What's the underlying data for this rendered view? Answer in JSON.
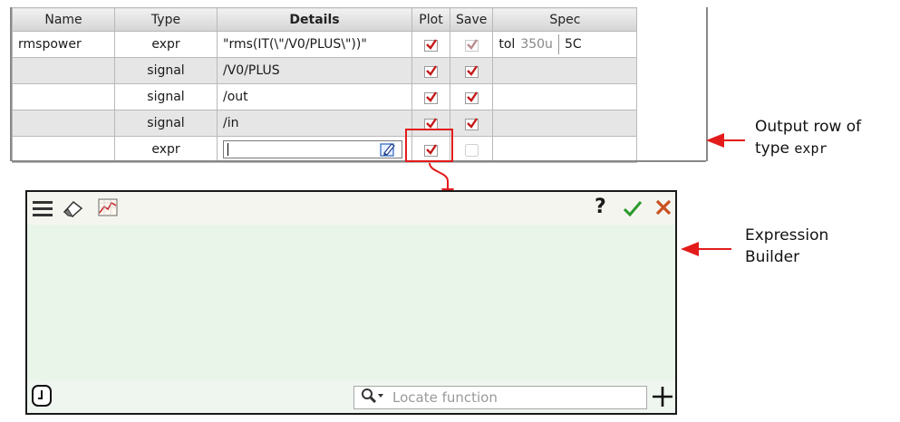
{
  "table": {
    "headers": [
      "Name",
      "Type",
      "Details",
      "Plot",
      "Save",
      "Spec"
    ],
    "rows": [
      {
        "name": "rmspower",
        "type": "expr",
        "details": "\"rms(IT(\\\"/V0/PLUS\\\"))\"",
        "plot": true,
        "save": true,
        "save_dim": true,
        "spec_label": "tol",
        "spec_value": "350u",
        "spec_extra": "5C"
      },
      {
        "name": "",
        "type": "signal",
        "details": "/V0/PLUS",
        "plot": true,
        "save": true
      },
      {
        "name": "",
        "type": "signal",
        "details": "/out",
        "plot": true,
        "save": true
      },
      {
        "name": "",
        "type": "signal",
        "details": "/in",
        "plot": true,
        "save": true
      },
      {
        "name": "",
        "type": "expr",
        "details": "",
        "plot": true,
        "save": false
      }
    ]
  },
  "builder": {
    "toolbar_icons": [
      "menu-icon",
      "eraser-icon",
      "plot-icon"
    ],
    "help_icon": "?",
    "accept_icon": "check-icon",
    "close_icon": "close-icon",
    "clock_icon": "clock-icon",
    "search_placeholder": "Locate function",
    "add_icon": "plus-icon"
  },
  "annotations": {
    "output_row_line1": "Output row of",
    "output_row_line2_prefix": "type ",
    "output_row_line2_code": "expr",
    "builder_line1": "Expression",
    "builder_line2": "Builder"
  },
  "colors": {
    "accent_red": "#e31b1b",
    "check_red": "#c41a1a",
    "accept_green": "#2a9a2a",
    "close_orange": "#c8501e"
  }
}
